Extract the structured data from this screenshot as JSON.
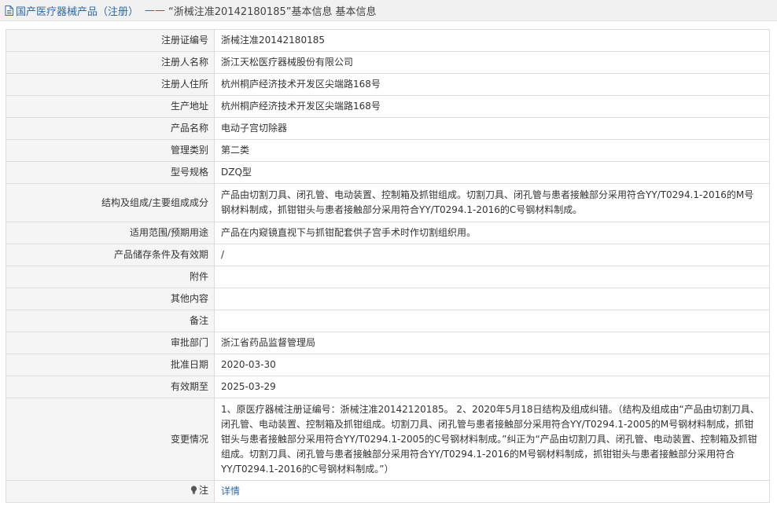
{
  "header": {
    "category": "国产医疗器械产品（注册）",
    "separator": "——",
    "product_title": "“浙械注准20142180185”基本信息"
  },
  "rows": [
    {
      "label": "注册证编号",
      "value": "浙械注准20142180185"
    },
    {
      "label": "注册人名称",
      "value": "浙江天松医疗器械股份有限公司"
    },
    {
      "label": "注册人住所",
      "value": "杭州桐庐经济技术开发区尖端路168号"
    },
    {
      "label": "生产地址",
      "value": "杭州桐庐经济技术开发区尖端路168号"
    },
    {
      "label": "产品名称",
      "value": "电动子宫切除器"
    },
    {
      "label": "管理类别",
      "value": "第二类"
    },
    {
      "label": "型号规格",
      "value": "DZQ型"
    },
    {
      "label": "结构及组成/主要组成成分",
      "value": "产品由切割刀具、闭孔管、电动装置、控制箱及抓钳组成。切割刀具、闭孔管与患者接触部分采用符合YY/T0294.1-2016的M号钢材料制成，抓钳钳头与患者接触部分采用符合YY/T0294.1-2016的C号钢材料制成。"
    },
    {
      "label": "适用范围/预期用途",
      "value": "产品在内窥镜直视下与抓钳配套供子宫手术时作切割组织用。"
    },
    {
      "label": "产品储存条件及有效期",
      "value": "/"
    },
    {
      "label": "附件",
      "value": ""
    },
    {
      "label": "其他内容",
      "value": ""
    },
    {
      "label": "备注",
      "value": ""
    },
    {
      "label": "审批部门",
      "value": "浙江省药品监督管理局"
    },
    {
      "label": "批准日期",
      "value": "2020-03-30"
    },
    {
      "label": "有效期至",
      "value": "2025-03-29"
    },
    {
      "label": "变更情况",
      "value": "1、原医疗器械注册证编号：浙械注准20142120185。 2、2020年5月18日结构及组成纠错。（结构及组成由“产品由切割刀具、闭孔管、电动装置、控制箱及抓钳组成。切割刀具、闭孔管与患者接触部分采用符合YY/T0294.1-2005的M号钢材料制成，抓钳钳头与患者接触部分采用符合YY/T0294.1-2005的C号钢材料制成。”纠正为“产品由切割刀具、闭孔管、电动装置、控制箱及抓钳组成。切割刀具、闭孔管与患者接触部分采用符合YY/T0294.1-2016的M号钢材料制成，抓钳钳头与患者接触部分采用符合YY/T0294.1-2016的C号钢材料制成。”）"
    }
  ],
  "note": {
    "label": "注",
    "icon": "lightbulb-icon",
    "link_text": "详情"
  },
  "colors": {
    "link": "#2d6aa8",
    "label_bg": "#f5f5f5",
    "border": "#dddddd",
    "title_bg": "#f1f1f1"
  }
}
